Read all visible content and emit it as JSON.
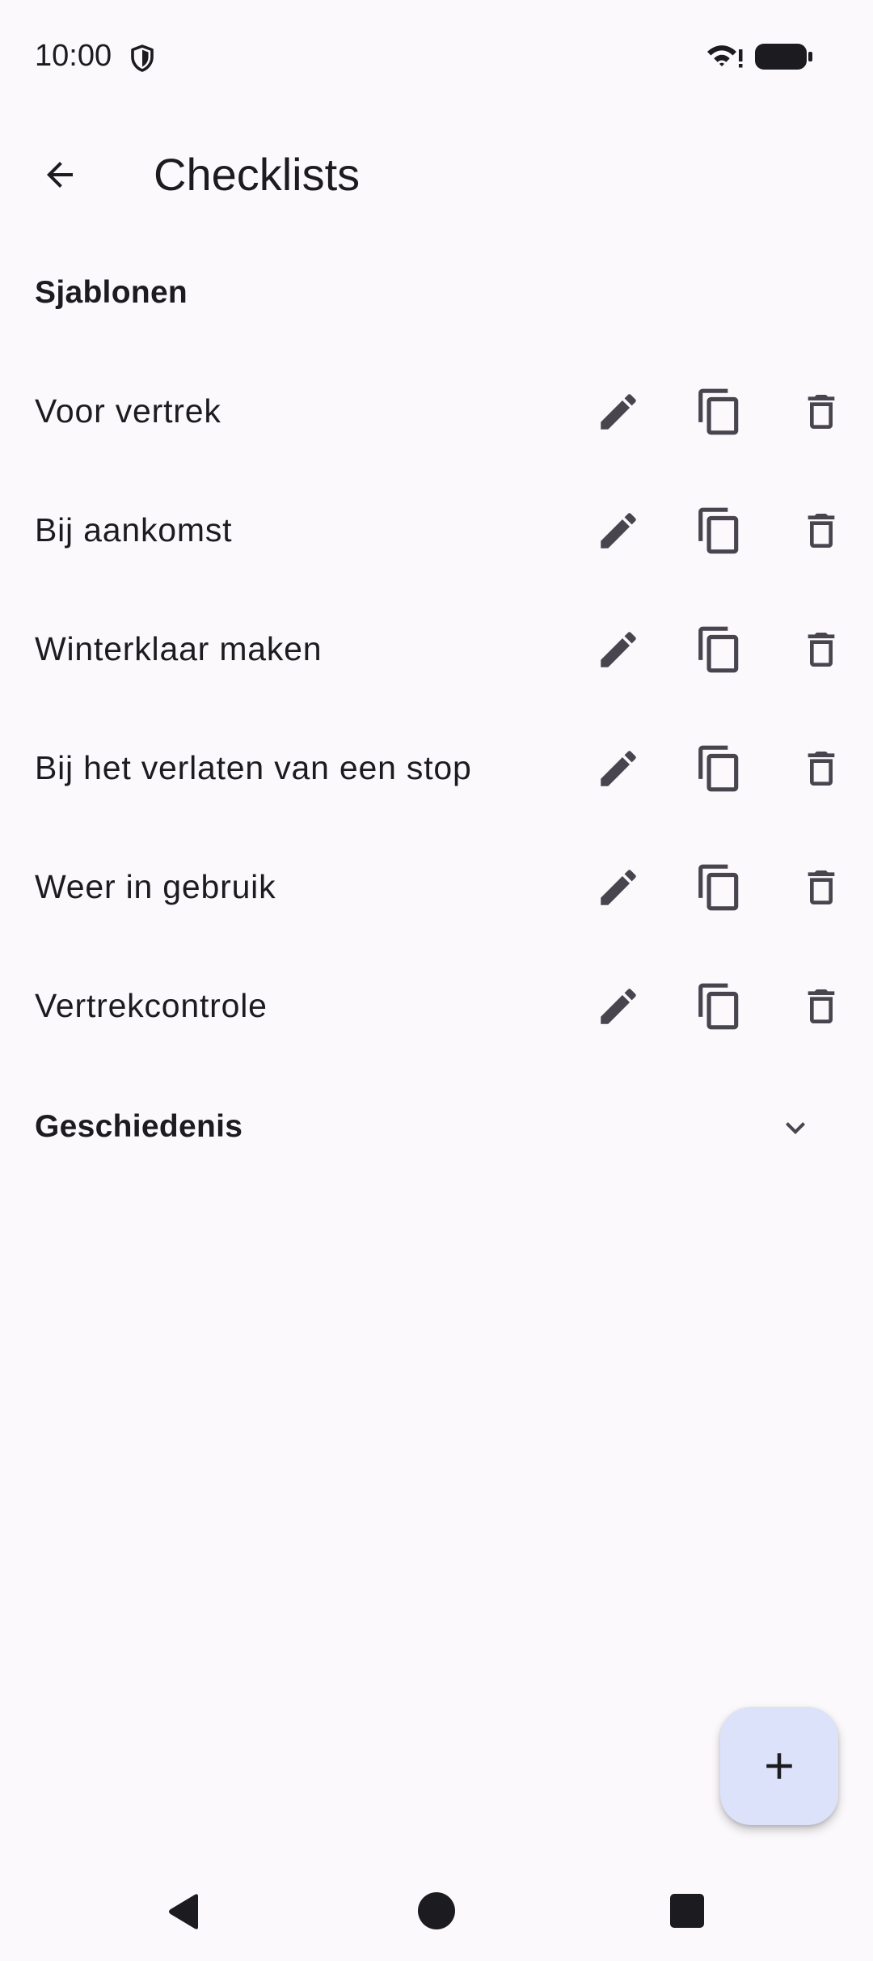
{
  "status_bar": {
    "time": "10:00",
    "icons": [
      "shield-icon",
      "wifi-icon",
      "battery-icon"
    ]
  },
  "app_bar": {
    "title": "Checklists",
    "back_icon": "arrow-back-icon"
  },
  "sections": {
    "templates_header": "Sjablonen",
    "history_header": "Geschiedenis"
  },
  "templates": [
    {
      "label": "Voor vertrek"
    },
    {
      "label": "Bij aankomst"
    },
    {
      "label": "Winterklaar maken"
    },
    {
      "label": "Bij het verlaten van een stop"
    },
    {
      "label": "Weer in gebruik"
    },
    {
      "label": "Vertrekcontrole"
    }
  ],
  "row_actions": [
    "edit-icon",
    "copy-icon",
    "delete-icon"
  ],
  "fab": {
    "icon": "add-icon"
  },
  "colors": {
    "background": "#fcf9fc",
    "icon": "#49454f",
    "text": "#1c1b1f",
    "fab_background": "#dbe2f9"
  }
}
